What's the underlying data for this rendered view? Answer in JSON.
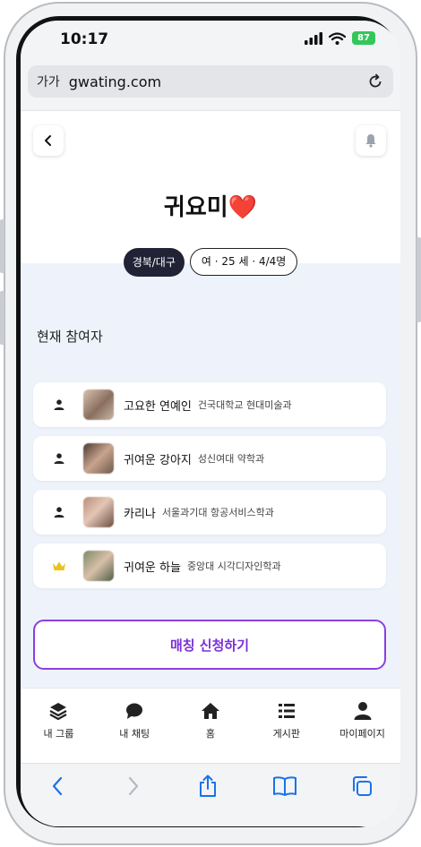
{
  "status_bar": {
    "time": "10:17",
    "battery": "87"
  },
  "browser": {
    "aa_label": "가가",
    "url": "gwating.com"
  },
  "page": {
    "title": "귀요미❤️",
    "tags": {
      "region": "경북/대구",
      "info": "여 · 25 세 · 4/4명"
    },
    "section_label": "현재 참여자",
    "participants": [
      {
        "role": "member",
        "nickname": "고요한 연예인",
        "school": "건국대학교 현대미술과"
      },
      {
        "role": "member",
        "nickname": "귀여운 강아지",
        "school": "성신여대 약학과"
      },
      {
        "role": "member",
        "nickname": "카리나",
        "school": "서울과기대 항공서비스학과"
      },
      {
        "role": "leader",
        "nickname": "귀여운 하늘",
        "school": "중앙대 시각디자인학과"
      }
    ],
    "cta_label": "매칭 신청하기"
  },
  "tab_bar": {
    "items": [
      {
        "label": "내 그룹",
        "icon": "layers-icon"
      },
      {
        "label": "내 채팅",
        "icon": "chat-bubble-icon"
      },
      {
        "label": "홈",
        "icon": "home-icon"
      },
      {
        "label": "게시판",
        "icon": "list-icon"
      },
      {
        "label": "마이페이지",
        "icon": "person-icon"
      }
    ]
  },
  "colors": {
    "accent": "#7a2fd8",
    "dark_tag": "#222236",
    "crown": "#e9c21c",
    "page_bg": "#eef3fb"
  }
}
